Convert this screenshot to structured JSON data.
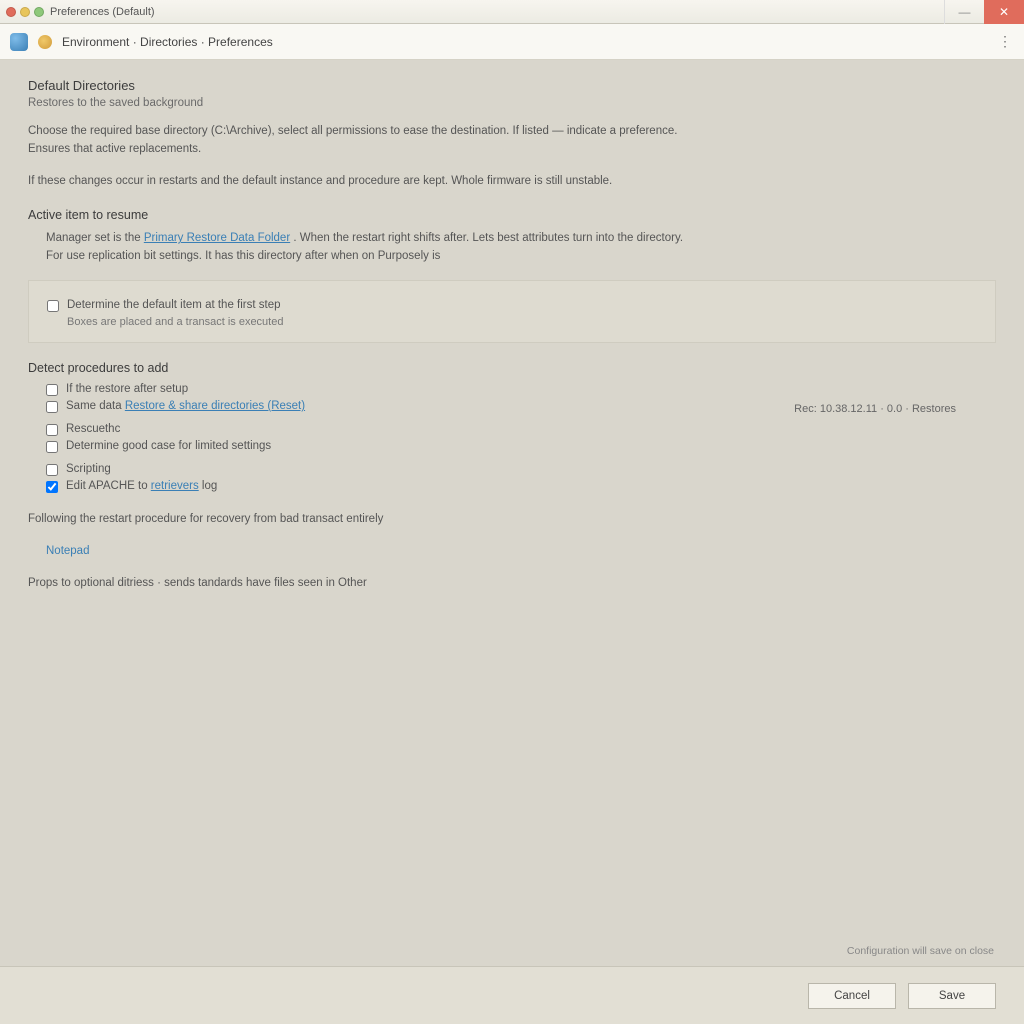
{
  "titlebar": {
    "title": "Preferences (Default)"
  },
  "toolbar": {
    "breadcrumb": "Environment · Directories · Preferences"
  },
  "page": {
    "heading": "Default Directories",
    "subheading": "Restores to the saved background",
    "intro1": "Choose the required base directory (C:\\Archive), select all permissions to ease the destination. If listed — indicate a preference.",
    "intro2": "Ensures that active replacements.",
    "note": "If these changes occur in restarts and the default instance and procedure are kept. Whole firmware is still unstable.",
    "section1": {
      "title": "Active item to resume",
      "line1a": "Manager set is the ",
      "line1_link": "Primary Restore Data Folder",
      "line1b": ". When the restart right shifts after. Lets best attributes turn into the directory.",
      "line2": "For use replication bit settings. It has this directory after when on Purposely is"
    },
    "boxed": {
      "check1": "Determine the default item at the first step",
      "check1_sub": "Boxes are placed and a transact is executed"
    },
    "section2": {
      "title": "Detect procedures to add",
      "opt1": "If the restore after setup",
      "opt2a": "Same data ",
      "opt2_link": "Restore & share directories (Reset)",
      "right_note": "Rec: 10.38.12.11 · 0.0 · Restores",
      "opt3": "Rescuethc",
      "opt4": "Determine good case for limited settings",
      "opt5": "Scripting",
      "opt6a": "Edit APACHE to ",
      "opt6_link": "retrievers",
      "opt6b": " log"
    },
    "section3": {
      "lead": "Following the restart procedure for recovery from bad transact entirely",
      "link": "Notepad"
    },
    "footnote": "Props to optional ditriess · sends tandards have files seen in Other"
  },
  "footer": {
    "hint": "Configuration will save on close",
    "cancel": "Cancel",
    "save": "Save"
  }
}
